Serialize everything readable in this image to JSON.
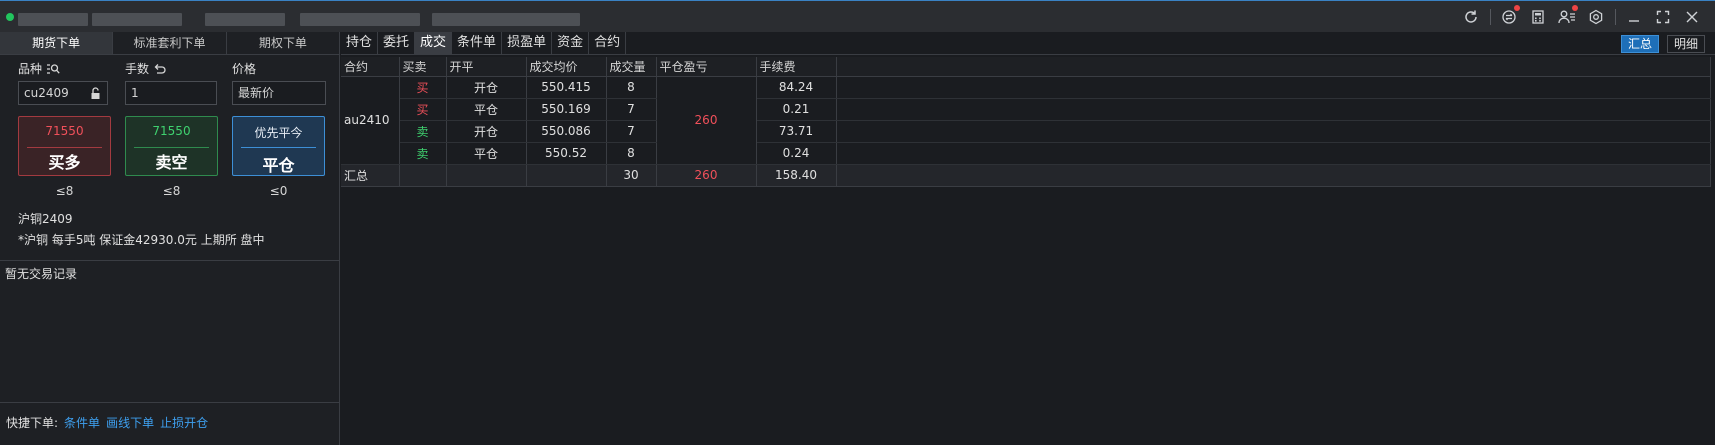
{
  "colors": {
    "accent": "#3d8fd6",
    "buy": "#f0505a",
    "sell": "#3fd16f",
    "status_dot": "#22c55e"
  },
  "titlebar": {
    "icons": [
      "refresh-icon",
      "exchange-icon",
      "calculator-icon",
      "user-list-icon",
      "settings-icon",
      "minimize-icon",
      "maximize-icon",
      "close-icon"
    ]
  },
  "left": {
    "tabs": [
      {
        "label": "期货下单"
      },
      {
        "label": "标准套利下单"
      },
      {
        "label": "期权下单"
      }
    ],
    "symbol": {
      "label": "品种",
      "value": "cu2409"
    },
    "quantity": {
      "label": "手数",
      "value": "1"
    },
    "price": {
      "label": "价格",
      "value": "最新价"
    },
    "buy": {
      "price": "71550",
      "label": "买多",
      "limit": "≤8"
    },
    "sell": {
      "price": "71550",
      "label": "卖空",
      "limit": "≤8"
    },
    "close": {
      "sub": "优先平今",
      "label": "平仓",
      "limit": "≤0"
    },
    "contract_name": "沪铜2409",
    "contract_info": "*沪铜 每手5吨 保证金42930.0元 上期所 盘中",
    "no_records": "暂无交易记录",
    "quick": {
      "label": "快捷下单:",
      "links": [
        "条件单",
        "画线下单",
        "止损开仓"
      ]
    }
  },
  "right": {
    "tabs": [
      "持仓",
      "委托",
      "成交",
      "条件单",
      "损盈单",
      "资金",
      "合约"
    ],
    "active_tab": "成交",
    "view_buttons": [
      "汇总",
      "明细"
    ],
    "columns": [
      "合约",
      "买卖",
      "开平",
      "成交均价",
      "成交量",
      "平仓盈亏",
      "手续费"
    ],
    "contract": "au2410",
    "rows": [
      {
        "side": "买",
        "open_close": "开仓",
        "avg_price": "550.415",
        "volume": "8",
        "fee": "84.24"
      },
      {
        "side": "买",
        "open_close": "平仓",
        "avg_price": "550.169",
        "volume": "7",
        "fee": "0.21"
      },
      {
        "side": "卖",
        "open_close": "开仓",
        "avg_price": "550.086",
        "volume": "7",
        "fee": "73.71"
      },
      {
        "side": "卖",
        "open_close": "平仓",
        "avg_price": "550.52",
        "volume": "8",
        "fee": "0.24"
      }
    ],
    "close_pnl": "260",
    "summary": {
      "label": "汇总",
      "volume": "30",
      "close_pnl": "260",
      "fee": "158.40"
    }
  }
}
